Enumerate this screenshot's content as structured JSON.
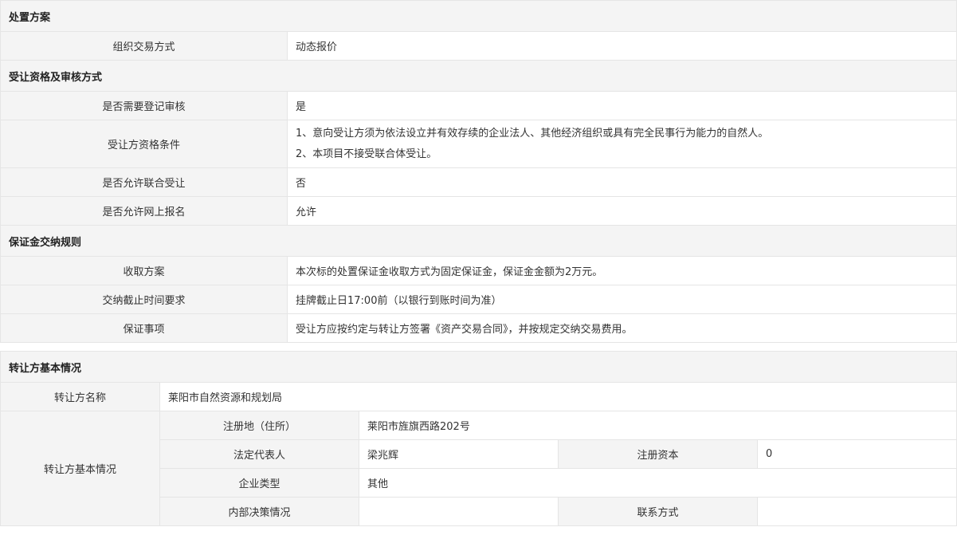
{
  "disposal": {
    "title": "处置方案",
    "rows": [
      {
        "label": "组织交易方式",
        "value": "动态报价"
      }
    ]
  },
  "qualification": {
    "title": "受让资格及审核方式",
    "rows": [
      {
        "label": "是否需要登记审核",
        "value": "是"
      },
      {
        "label": "受让方资格条件",
        "lines": [
          "1、意向受让方须为依法设立并有效存续的企业法人、其他经济组织或具有完全民事行为能力的自然人。",
          "2、本项目不接受联合体受让。"
        ]
      },
      {
        "label": "是否允许联合受让",
        "value": "否"
      },
      {
        "label": "是否允许网上报名",
        "value": "允许"
      }
    ]
  },
  "deposit": {
    "title": "保证金交纳规则",
    "rows": [
      {
        "label": "收取方案",
        "value": "本次标的处置保证金收取方式为固定保证金，保证金金额为2万元。"
      },
      {
        "label": "交纳截止时间要求",
        "value": "挂牌截止日17:00前（以银行到账时间为准）"
      },
      {
        "label": "保证事项",
        "value": "受让方应按约定与转让方签署《资产交易合同》，并按规定交纳交易费用。"
      }
    ]
  },
  "transferor": {
    "title": "转让方基本情况",
    "name_label": "转让方名称",
    "name_value": "莱阳市自然资源和规划局",
    "basic_label": "转让方基本情况",
    "address_label": "注册地（住所）",
    "address_value": "莱阳市旌旗西路202号",
    "legal_rep_label": "法定代表人",
    "legal_rep_value": "梁兆辉",
    "capital_label": "注册资本",
    "capital_value": "0",
    "type_label": "企业类型",
    "type_value": "其他",
    "decision_label": "内部决策情况",
    "decision_value": "",
    "contact_label": "联系方式",
    "contact_value": ""
  }
}
